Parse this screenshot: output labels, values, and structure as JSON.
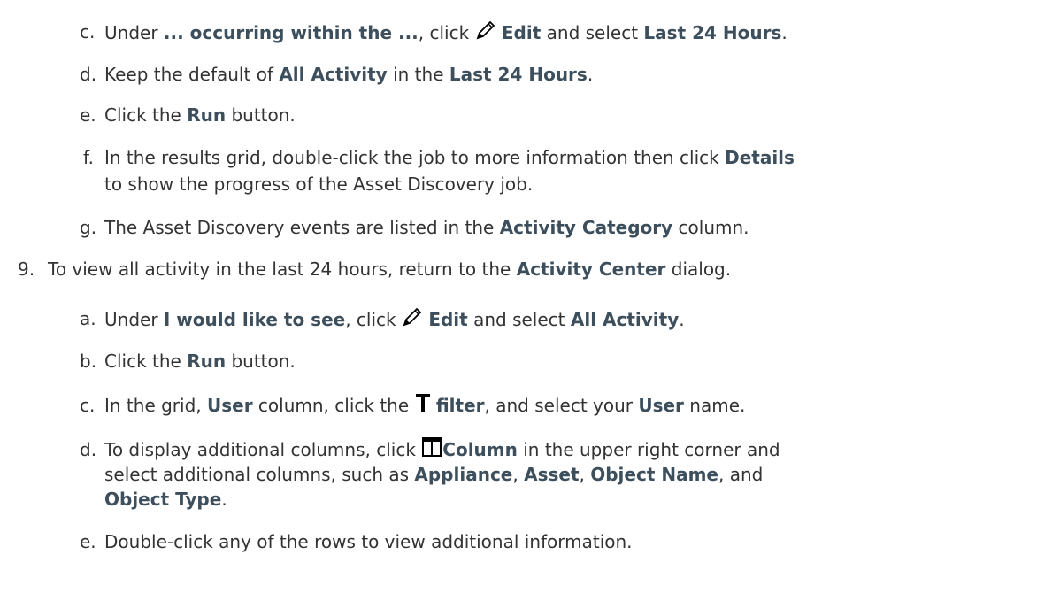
{
  "steps": {
    "c1": {
      "marker": "c.",
      "t1": "Under ",
      "b1": "... occurring within the ...",
      "t2": ", click ",
      "icon": "pencil-icon",
      "b2": "Edit",
      "t3": " and select ",
      "b3": "Last 24 Hours",
      "t4": "."
    },
    "d1": {
      "marker": "d.",
      "t1": "Keep the default of ",
      "b1": "All Activity",
      "t2": " in the ",
      "b2": "Last 24 Hours",
      "t3": "."
    },
    "e1": {
      "marker": "e.",
      "t1": "Click the ",
      "b1": "Run",
      "t2": " button."
    },
    "f1": {
      "marker": "f.",
      "t1": "In the results grid, double-click the job to more information then click ",
      "b1": "Details",
      "line2": "to show the progress of the Asset Discovery job."
    },
    "g1": {
      "marker": "g.",
      "t1": "The Asset Discovery events are listed in the ",
      "b1": "Activity Category",
      "t2": " column."
    },
    "s9": {
      "marker": "9.",
      "t1": "To view all activity in the last 24 hours, return to the ",
      "b1": "Activity Center",
      "t2": " dialog."
    },
    "a2": {
      "marker": "a.",
      "t1": "Under ",
      "b1": "I would like to see",
      "t2": ", click ",
      "icon": "pencil-icon",
      "b2": "Edit",
      "t3": " and select ",
      "b3": "All Activity",
      "t4": "."
    },
    "b2": {
      "marker": "b.",
      "t1": "Click the ",
      "b1": "Run",
      "t2": " button."
    },
    "c2": {
      "marker": "c.",
      "t1": "In the grid, ",
      "b1": "User",
      "t2": " column, click the ",
      "icon": "filter-icon",
      "b2": "filter",
      "t3": ", and select your ",
      "b3": "User",
      "t4": " name."
    },
    "d2": {
      "marker": "d.",
      "t1": "To display additional columns, click ",
      "icon": "column-icon",
      "b1": "Column",
      "t2": " in the upper right corner and",
      "line2_t1": "select additional columns, such as ",
      "line2_b1": "Appliance",
      "line2_t2": ", ",
      "line2_b2": "Asset",
      "line2_t3": ", ",
      "line2_b3": "Object Name",
      "line2_t4": ", and",
      "line3_b1": "Object Type",
      "line3_t1": "."
    },
    "e2": {
      "marker": "e.",
      "t1": "Double-click any of the rows to view additional information."
    }
  },
  "colors": {
    "text": "#333333",
    "bold": "#3d4f5c",
    "background": "#ffffff"
  }
}
